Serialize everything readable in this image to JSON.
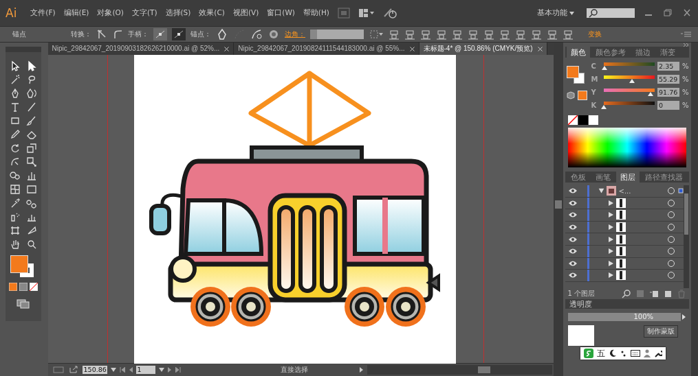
{
  "app": {
    "logo": "Ai"
  },
  "menu": [
    "文件(F)",
    "编辑(E)",
    "对象(O)",
    "文字(T)",
    "选择(S)",
    "效果(C)",
    "视图(V)",
    "窗口(W)",
    "帮助(H)"
  ],
  "workspace": "基本功能",
  "control_bar": {
    "label": "锚点",
    "convert": "转换：",
    "handles": "手柄：",
    "anchors": "锚点：",
    "corner": "边角：",
    "transform": "变换"
  },
  "doc_tabs": [
    {
      "label": "Nipic_29842067_20190903182626210000.ai @ 52%...",
      "selected": false
    },
    {
      "label": "Nipic_29842067_20190824111544183000.ai @ 55%...",
      "selected": false
    },
    {
      "label": "未标题-4* @ 150.86% (CMYK/预览)",
      "selected": true
    }
  ],
  "color_panel": {
    "tabs": [
      {
        "label": "颜色",
        "selected": true
      },
      {
        "label": "颜色参考",
        "selected": false
      },
      {
        "label": "描边",
        "selected": false
      },
      {
        "label": "渐变",
        "selected": false
      }
    ],
    "sliders": [
      {
        "channel": "C",
        "level": 0.02,
        "value": "2.35",
        "unit": "%"
      },
      {
        "channel": "M",
        "level": 0.55,
        "value": "55.29",
        "unit": "%"
      },
      {
        "channel": "Y",
        "level": 0.92,
        "value": "91.76",
        "unit": "%"
      },
      {
        "channel": "K",
        "level": 0,
        "value": "0",
        "unit": "%"
      }
    ]
  },
  "layers_panel": {
    "tabs": [
      {
        "label": "色板",
        "selected": false
      },
      {
        "label": "画笔",
        "selected": false
      },
      {
        "label": "图层",
        "selected": true
      },
      {
        "label": "路径查找器",
        "selected": false
      }
    ],
    "layers": [
      {
        "name": "<...",
        "expanded": true,
        "children": [
          {
            "expanded": false
          },
          {
            "expanded": false
          },
          {
            "expanded": false
          },
          {
            "expanded": false
          },
          {
            "expanded": false
          },
          {
            "expanded": false
          },
          {
            "expanded": false
          }
        ]
      }
    ],
    "footer": "1 个图层"
  },
  "transparency_panel": {
    "title": "透明度",
    "opacity": "100%",
    "make_mask": "制作蒙版"
  },
  "ime_bar": {
    "label": "五"
  },
  "status_bar": {
    "zoom": "150.86",
    "artboard": "1",
    "tool": "直接选择"
  }
}
